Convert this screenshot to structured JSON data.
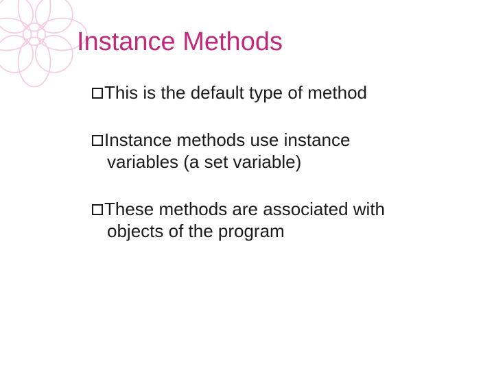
{
  "slide": {
    "title": "Instance Methods",
    "bullets": [
      {
        "first": "This",
        "rest": " is the default type of method",
        "cont": ""
      },
      {
        "first": "Instance",
        "rest": " methods use instance",
        "cont": "variables (a set variable)"
      },
      {
        "first": "These",
        "rest": " methods are associated with",
        "cont": "objects of the program"
      }
    ]
  }
}
